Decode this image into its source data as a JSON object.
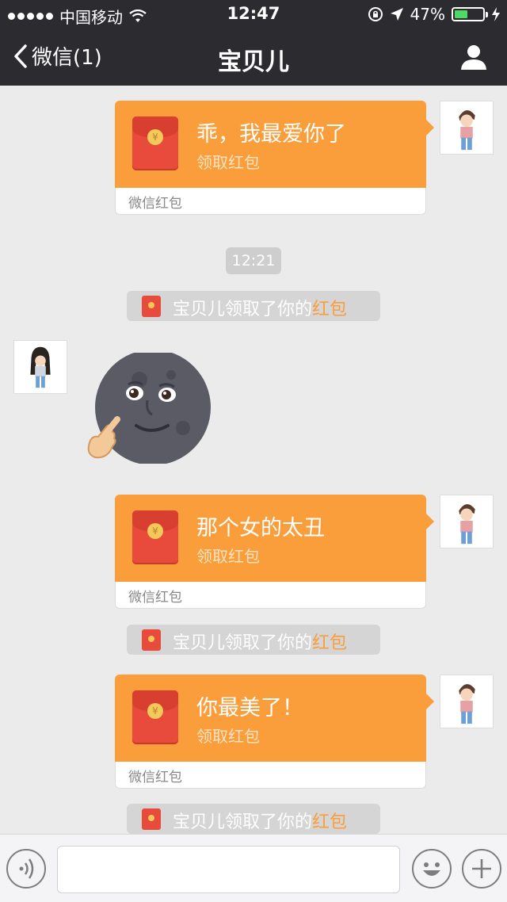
{
  "status_bar": {
    "carrier": "中国移动",
    "time": "12:47",
    "battery_percent": "47%",
    "battery_level": 0.47
  },
  "nav": {
    "back_label": "微信(1)",
    "title": "宝贝儿"
  },
  "messages": {
    "hongbao_1": {
      "text": "乖，我最爱你了",
      "sub": "领取红包",
      "footer": "微信红包"
    },
    "timestamp": "12:21",
    "notice_1": {
      "prefix": "宝贝儿领取了你的",
      "highlight": "红包"
    },
    "hongbao_2": {
      "text": "那个女的太丑",
      "sub": "领取红包",
      "footer": "微信红包"
    },
    "notice_2": {
      "prefix": "宝贝儿领取了你的",
      "highlight": "红包"
    },
    "hongbao_3": {
      "text": "你最美了！",
      "sub": "领取红包",
      "footer": "微信红包"
    },
    "notice_3": {
      "prefix": "宝贝儿领取了你的",
      "highlight": "红包"
    }
  },
  "colors": {
    "hongbao_orange": "#fa9d3b",
    "envelope_red": "#e84b3c",
    "nav_bg": "#2b2b30",
    "chat_bg": "#ebebeb"
  },
  "icons": {
    "back": "chevron-left-icon",
    "user": "person-icon",
    "voice": "voice-icon",
    "emoji": "emoji-icon",
    "plus": "plus-icon"
  }
}
